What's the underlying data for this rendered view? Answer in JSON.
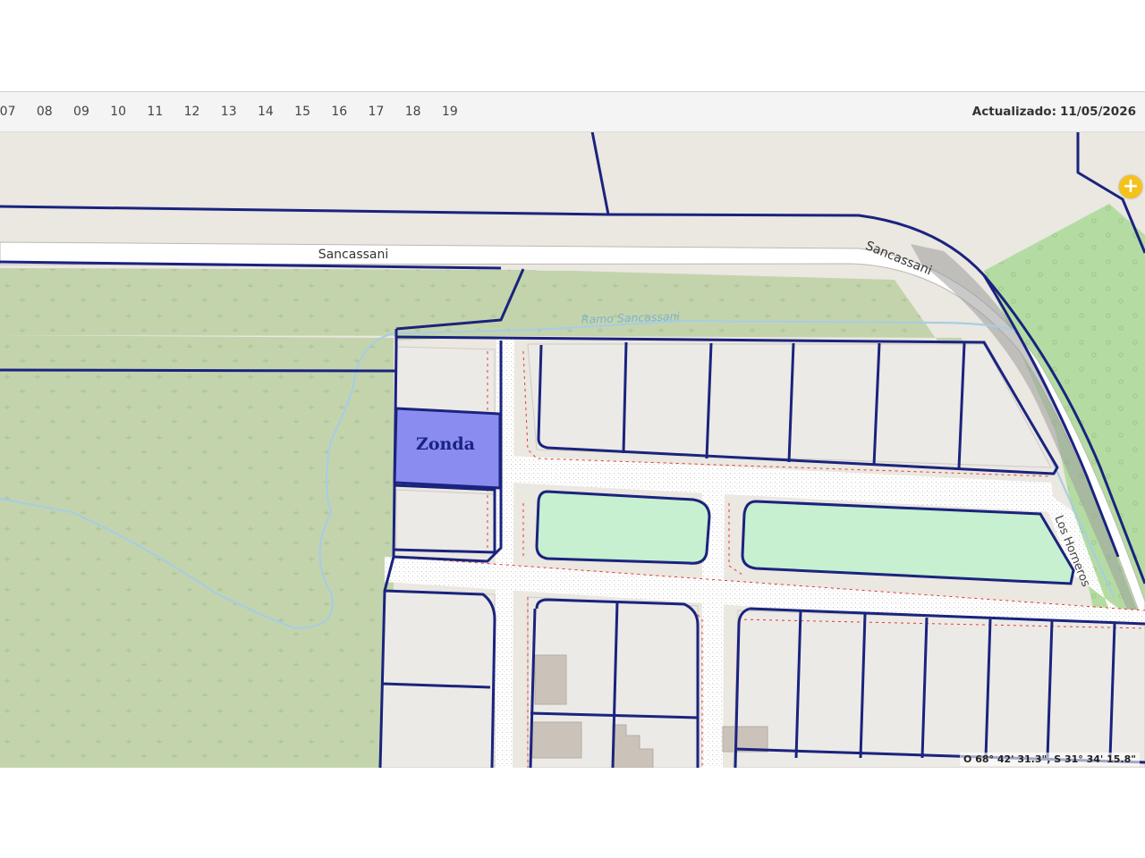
{
  "toolbar": {
    "hours": [
      "07",
      "08",
      "09",
      "10",
      "11",
      "12",
      "13",
      "14",
      "15",
      "16",
      "17",
      "18",
      "19"
    ],
    "updated_label": "Actualizado:",
    "updated_date": "11/05/2026"
  },
  "map": {
    "street_labels": [
      "Sancassani",
      "Sancassani",
      "Los Horneros"
    ],
    "stream_label": "Ramo Sancassani",
    "highlighted_parcel_label": "Zonda",
    "coordinates": "O 68° 42' 31.3\", S 31° 34' 15.8\"",
    "zoom_in_symbol": "+"
  },
  "colors": {
    "parcel_outline": "#1a237e",
    "highlight_fill": "#8a8cf0",
    "park_fill": "#c6f0cf",
    "vegetation_fill": "#c3d4ad",
    "road_fill": "#ffffff",
    "background": "#ebe7e1",
    "zoom_button": "#f4c21a",
    "stream": "#a8cde0",
    "setback_line": "#e53935"
  }
}
